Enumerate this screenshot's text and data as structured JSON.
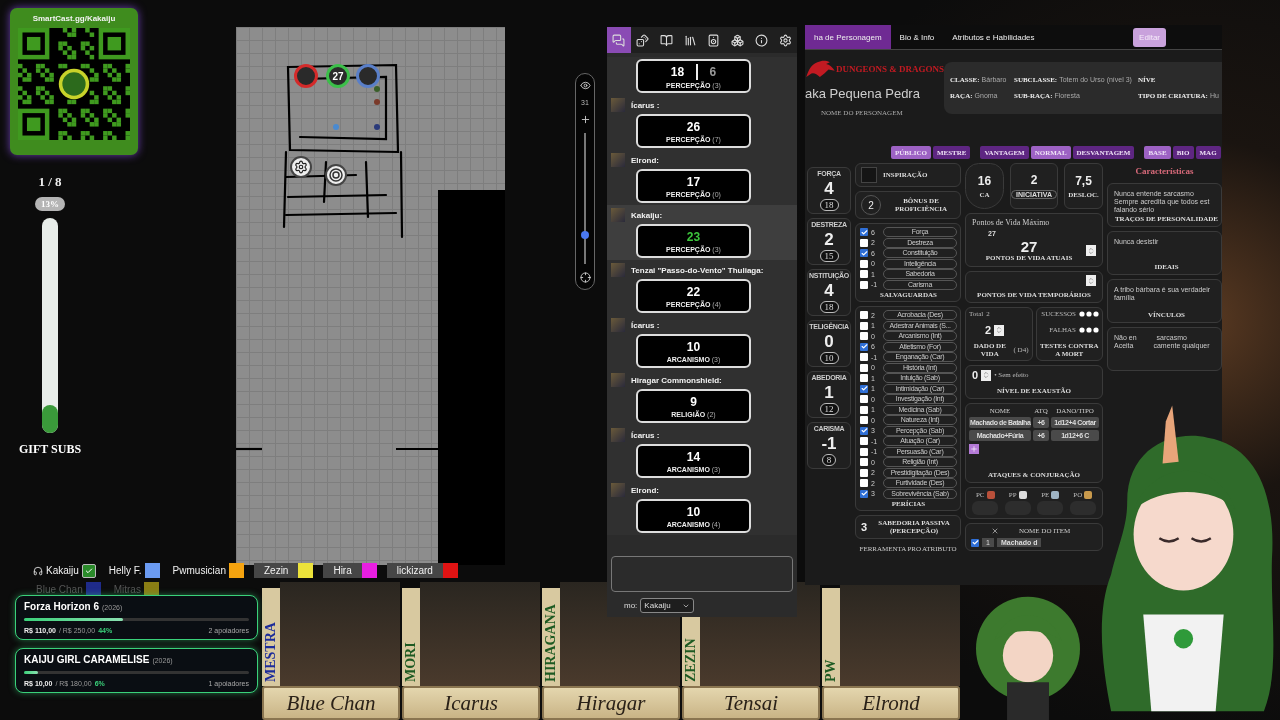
{
  "qr_card": {
    "title": "SmartCast.gg/Kakaiju"
  },
  "gift_goal": {
    "count": "1 / 8",
    "percent": "13%",
    "level": 0.13,
    "label": "GIFT SUBS"
  },
  "map": {
    "tokens": [
      {
        "kind": "ring",
        "color": "#d42a2a"
      },
      {
        "kind": "label",
        "color": "#3cbf4a",
        "label": "27"
      },
      {
        "kind": "ring",
        "color": "#5a7fc8"
      },
      {
        "kind": "gear"
      },
      {
        "kind": "spiral"
      }
    ],
    "zoom": {
      "value": "31",
      "level": 0.22
    }
  },
  "chat": {
    "tabs": [
      {
        "kind": "chat",
        "selected": true
      },
      {
        "kind": "dice",
        "selected": false
      },
      {
        "kind": "journal",
        "selected": false
      },
      {
        "kind": "library",
        "selected": false
      },
      {
        "kind": "jukebox",
        "selected": false
      },
      {
        "kind": "cards",
        "selected": false
      },
      {
        "kind": "info",
        "selected": false
      },
      {
        "kind": "settings",
        "selected": false
      }
    ],
    "messages": [
      {
        "selected": false,
        "rolls": [
          {
            "value": "18",
            "kind": "kept"
          },
          {
            "value": "6",
            "kind": "dropped"
          }
        ],
        "skill": "PERCEPÇÃO",
        "bonus": "(3)"
      },
      {
        "name": "Ícarus :",
        "selected": false,
        "rolls": [
          {
            "value": "26",
            "kind": "kept"
          }
        ],
        "skill": "PERCEPÇÃO",
        "bonus": "(7)"
      },
      {
        "name": "Elrond:",
        "selected": false,
        "rolls": [
          {
            "value": "17",
            "kind": "kept"
          }
        ],
        "skill": "PERCEPÇÃO",
        "bonus": "(0)"
      },
      {
        "name": "Kakaiju:",
        "selected": true,
        "rolls": [
          {
            "value": "23",
            "kind": "best"
          }
        ],
        "skill": "PERCEPÇÃO",
        "bonus": "(3)"
      },
      {
        "name": "Tenzai \"Passo-do-Vento\" Thuliaga:",
        "selected": false,
        "rolls": [
          {
            "value": "22",
            "kind": "kept"
          }
        ],
        "skill": "PERCEPÇÃO",
        "bonus": "(4)"
      },
      {
        "name": "Ícarus :",
        "selected": false,
        "rolls": [
          {
            "value": "10",
            "kind": "kept"
          }
        ],
        "skill": "ARCANISMO",
        "bonus": "(3)"
      },
      {
        "name": "Hiragar Commonshield:",
        "selected": false,
        "rolls": [
          {
            "value": "9",
            "kind": "kept"
          }
        ],
        "skill": "RELIGIÃO",
        "bonus": "(2)"
      },
      {
        "name": "Ícarus :",
        "selected": false,
        "rolls": [
          {
            "value": "14",
            "kind": "kept"
          }
        ],
        "skill": "ARCANISMO",
        "bonus": "(3)"
      },
      {
        "name": "Elrond:",
        "selected": false,
        "rolls": [
          {
            "value": "10",
            "kind": "kept"
          }
        ],
        "skill": "ARCANISMO",
        "bonus": "(4)"
      }
    ],
    "speaker": {
      "label": "mo:",
      "value": "Kakaiju"
    }
  },
  "sheet": {
    "tabs": [
      {
        "label": "ha de Personagem",
        "selected": true
      },
      {
        "label": "Bio & Info",
        "selected": false
      },
      {
        "label": "Atributos e Habilidades",
        "selected": false
      }
    ],
    "edit_button": "Editar",
    "logo": "DUNGEONS & DRAGONS",
    "character_name": "aka Pequena Pedra",
    "name_caption": "NOME DO PERSONAGEM",
    "details": [
      {
        "label": "CLASSE:",
        "value": "Bárbaro"
      },
      {
        "label": "SUBCLASSE:",
        "value": "Totem do Urso (nível 3)"
      },
      {
        "label": "NÍVE"
      },
      {
        "label": "RAÇA:",
        "value": "Gnoma"
      },
      {
        "label": "SUB-RAÇA:",
        "value": "Floresta"
      },
      {
        "label": "TIPO DE CRIATURA:",
        "value": "Hu"
      }
    ],
    "toggle_groups": [
      {
        "buttons": [
          {
            "label": "PÚBLICO",
            "selected": true
          },
          {
            "label": "MESTRE",
            "selected": false
          }
        ]
      },
      {
        "buttons": [
          {
            "label": "VANTAGEM",
            "selected": false
          },
          {
            "label": "NORMAL",
            "selected": true
          },
          {
            "label": "DESVANTAGEM",
            "selected": false
          }
        ]
      },
      {
        "buttons": [
          {
            "label": "BASE",
            "selected": true
          },
          {
            "label": "BIO",
            "selected": false
          },
          {
            "label": "MAG",
            "selected": false
          }
        ]
      }
    ],
    "abilities": [
      {
        "label": "FORÇA",
        "modifier": "4",
        "score": "18"
      },
      {
        "label": "DESTREZA",
        "modifier": "2",
        "score": "15"
      },
      {
        "label": "NSTITUIÇÃO",
        "modifier": "4",
        "score": "18"
      },
      {
        "label": "TELIGÊNCIA",
        "modifier": "0",
        "score": "10"
      },
      {
        "label": "ABEDORIA",
        "modifier": "1",
        "score": "12"
      },
      {
        "label": "CARISMA",
        "modifier": "-1",
        "score": "8"
      }
    ],
    "inspiration": {
      "label": "INSPIRAÇÃO"
    },
    "proficiency": {
      "value": "2",
      "label": "BÔNUS DE PROFICIÊNCIA"
    },
    "saving_throws": {
      "title": "SALVAGUARDAS",
      "items": [
        {
          "value": "6",
          "label": "Força",
          "checked": true
        },
        {
          "value": "2",
          "label": "Destreza",
          "checked": false
        },
        {
          "value": "6",
          "label": "Constituição",
          "checked": true
        },
        {
          "value": "0",
          "label": "Inteligência",
          "checked": false
        },
        {
          "value": "1",
          "label": "Sabedoria",
          "checked": false
        },
        {
          "value": "-1",
          "label": "Carisma",
          "checked": false
        }
      ]
    },
    "skills": {
      "title": "PERÍCIAS",
      "items": [
        {
          "value": "2",
          "label": "Acrobacia (Des)",
          "checked": false
        },
        {
          "value": "1",
          "label": "Adestrar Animais (S...",
          "checked": false
        },
        {
          "value": "0",
          "label": "Arcanismo (Int)",
          "checked": false
        },
        {
          "value": "6",
          "label": "Atletismo (For)",
          "checked": true
        },
        {
          "value": "-1",
          "label": "Enganação (Car)",
          "checked": false
        },
        {
          "value": "0",
          "label": "História (Int)",
          "checked": false
        },
        {
          "value": "1",
          "label": "Intuição (Sab)",
          "checked": false
        },
        {
          "value": "1",
          "label": "Intimidação (Car)",
          "checked": true
        },
        {
          "value": "0",
          "label": "Investigação (Int)",
          "checked": false
        },
        {
          "value": "1",
          "label": "Medicina (Sab)",
          "checked": false
        },
        {
          "value": "0",
          "label": "Natureza (Int)",
          "checked": false
        },
        {
          "value": "3",
          "label": "Percepção (Sab)",
          "checked": true
        },
        {
          "value": "-1",
          "label": "Atuação (Car)",
          "checked": false
        },
        {
          "value": "-1",
          "label": "Persuasão (Car)",
          "checked": false
        },
        {
          "value": "0",
          "label": "Religião (Int)",
          "checked": false
        },
        {
          "value": "2",
          "label": "Prestidigitação (Des)",
          "checked": false
        },
        {
          "value": "2",
          "label": "Furtividade (Des)",
          "checked": false
        },
        {
          "value": "3",
          "label": "Sobrevivência (Sab)",
          "checked": true
        }
      ]
    },
    "passive": {
      "value": "3",
      "label": "SABEDORIA PASSIVA (PERCEPÇÃO)"
    },
    "tools": {
      "columns": [
        "FERRAMENTA",
        "PRO",
        "ATRIBUTO"
      ]
    },
    "combat": [
      {
        "value": "16",
        "label": "CA",
        "kind": "shield"
      },
      {
        "value": "2",
        "label": "INICIATIVA",
        "kind": "pill"
      },
      {
        "value": "7,5",
        "label": "DESLOC.",
        "kind": "plain"
      }
    ],
    "hit_points": {
      "max_label": "Pontos de Vida Máximo",
      "max": "27",
      "current": "27",
      "current_label": "PONTOS DE VIDA ATUAIS",
      "temp_label": "PONTOS DE VIDA TEMPORÁRIOS"
    },
    "hit_dice": {
      "total_label": "Total",
      "total": "2",
      "value": "2",
      "label": "DADO DE VIDA",
      "die": "( D4)"
    },
    "death_saves": {
      "rows": [
        {
          "label": "SUCESSOS"
        },
        {
          "label": "FALHAS"
        }
      ],
      "title": "TESTES CONTRA A MORT"
    },
    "exhaustion": {
      "value": "0",
      "note": "• Sem efeito",
      "label": "NÍVEL DE EXAUSTÃO"
    },
    "attacks": {
      "columns": [
        "NOME",
        "ATQ",
        "DANO/TIPO"
      ],
      "rows": [
        [
          "Machado de Batalha",
          "+6",
          "1d12+4 Cortar"
        ],
        [
          "Machado+Fúria",
          "+6",
          "1d12+6 C"
        ]
      ],
      "title": "ATAQUES & CONJURAÇÃO"
    },
    "coins": [
      "PC",
      "PP",
      "PE",
      "PO"
    ],
    "items": {
      "header": "NOME DO ITEM",
      "rows": [
        {
          "checked": true,
          "quantity": "1",
          "name": "Machado d"
        }
      ]
    },
    "characteristics": {
      "title": "Características",
      "blocks": [
        {
          "kind": "text",
          "lines": [
            "Nunca entende sarcasmo",
            "Sempre acredita que todos est",
            "falando sério"
          ],
          "label": "TRAÇOS DE PERSONALIDADE"
        },
        {
          "kind": "text",
          "lines": [
            "Nunca desistir"
          ],
          "label": "IDEAIS"
        },
        {
          "kind": "text",
          "lines": [
            "A tribo bárbara é sua verdadeir",
            "família"
          ],
          "label": "VÍNCULOS"
        },
        {
          "kind": "split",
          "rows": [
            {
              "left": "Não en",
              "right": "sarcasmo"
            },
            {
              "left": "Aceita",
              "right": "camente qualquer"
            }
          ]
        }
      ]
    }
  },
  "legend": [
    {
      "kind": "self",
      "name": "Kakaiju",
      "checked": true,
      "highlighted": false,
      "dimmed": false
    },
    {
      "kind": "player",
      "name": "Helly F.",
      "color": "#6b9bf2",
      "highlighted": false,
      "dimmed": false
    },
    {
      "kind": "player",
      "name": "Pwmusician",
      "color": "#f5a30f",
      "highlighted": false,
      "dimmed": false
    },
    {
      "kind": "player",
      "name": "Zezin",
      "color": "#ece23a",
      "highlighted": true,
      "dimmed": false
    },
    {
      "kind": "player",
      "name": "Hira",
      "color": "#e81ee0",
      "highlighted": true,
      "dimmed": false
    },
    {
      "kind": "player",
      "name": "lickizard",
      "color": "#e01313",
      "highlighted": true,
      "dimmed": false
    },
    {
      "kind": "player",
      "name": "Blue Chan",
      "color": "#1f2b8a",
      "highlighted": false,
      "dimmed": true
    },
    {
      "kind": "player",
      "name": "Mitras",
      "color": "#8a7d14",
      "highlighted": false,
      "dimmed": true
    }
  ],
  "goals": [
    {
      "title": "Forza Horizon 6",
      "year": "(2026)",
      "raised": "R$ 110,00",
      "target": "/ R$ 250,00",
      "percent": "44%",
      "level": 0.44,
      "backers": "2 apoiadores"
    },
    {
      "title": "KAIJU GIRL CARAMELISE",
      "year": "(2026)",
      "raised": "R$ 10,00",
      "target": "/ R$ 180,00",
      "percent": "6%",
      "level": 0.06,
      "backers": "1 apoiadores"
    }
  ],
  "party": [
    {
      "tag": "MESTRA",
      "name": "Blue Chan",
      "kind": "gm"
    },
    {
      "tag": "MORI",
      "name": "Icarus",
      "kind": "player"
    },
    {
      "tag": "HIRAGANA",
      "name": "Hiragar",
      "kind": "player"
    },
    {
      "tag": "ZEZIN",
      "name": "Tensai",
      "kind": "player"
    },
    {
      "tag": "PW",
      "name": "Elrond",
      "kind": "player"
    }
  ]
}
